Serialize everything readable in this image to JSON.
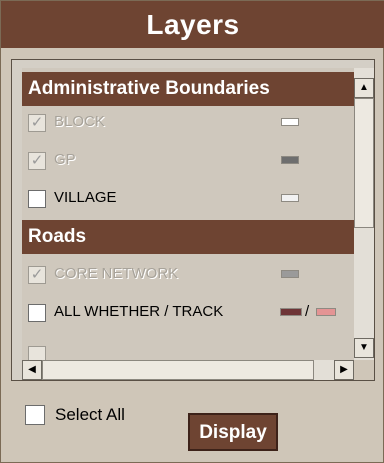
{
  "header": {
    "title": "Layers"
  },
  "groups": [
    {
      "title": "Administrative Boundaries",
      "items": [
        {
          "label": "BLOCK",
          "checked": true,
          "disabled": true,
          "swatch_colors": [
            "#ffffff"
          ]
        },
        {
          "label": "GP",
          "checked": true,
          "disabled": true,
          "swatch_colors": [
            "#6e6e6e"
          ]
        },
        {
          "label": "VILLAGE",
          "checked": false,
          "disabled": false,
          "swatch_colors": [
            "#f1f1f1"
          ]
        }
      ]
    },
    {
      "title": "Roads",
      "items": [
        {
          "label": "CORE NETWORK",
          "checked": true,
          "disabled": true,
          "swatch_colors": [
            "#9a9a9a"
          ]
        },
        {
          "label": "ALL WHETHER / TRACK",
          "checked": false,
          "disabled": false,
          "swatch_colors": [
            "#6e3436",
            "#e49494"
          ],
          "swatch_separator": "/"
        }
      ]
    }
  ],
  "footer": {
    "select_all_label": "Select All",
    "select_all_checked": false,
    "display_label": "Display"
  },
  "scrollbar": {
    "up_icon": "arrow-up-icon",
    "down_icon": "arrow-down-icon",
    "left_icon": "arrow-left-icon",
    "right_icon": "arrow-right-icon"
  },
  "colors": {
    "accent": "#6e4432",
    "panel_bg": "#cfc6b8"
  }
}
